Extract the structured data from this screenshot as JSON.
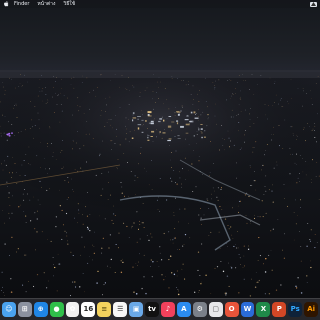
{
  "menubar": {
    "menus": [
      {
        "label": "Finder"
      },
      {
        "label": "หน้าต่าง"
      },
      {
        "label": "วิธีใช้"
      }
    ]
  },
  "desktop": {
    "wallpaper": "night-city-aerial"
  },
  "dock": {
    "apps": [
      {
        "name": "finder-icon",
        "bg": "#4aa3ef",
        "glyph": "☺"
      },
      {
        "name": "launchpad-icon",
        "bg": "#8c92a0",
        "glyph": "⊞"
      },
      {
        "name": "safari-icon",
        "bg": "#1f86e6",
        "glyph": "⊕"
      },
      {
        "name": "messages-icon",
        "bg": "#2fbf4a",
        "glyph": "●"
      },
      {
        "name": "photos-icon",
        "bg": "#f1f1f1",
        "glyph": "✿"
      },
      {
        "name": "calendar-icon",
        "bg": "#ffffff",
        "glyph": "16",
        "fg": "#222222"
      },
      {
        "name": "notes-icon",
        "bg": "#f4d35e",
        "glyph": "≡",
        "fg": "#6a5a1a"
      },
      {
        "name": "reminders-icon",
        "bg": "#f7f7f7",
        "glyph": "☰",
        "fg": "#444444"
      },
      {
        "name": "preview-icon",
        "bg": "#6aa9e8",
        "glyph": "▣"
      },
      {
        "name": "apple-tv-icon",
        "bg": "#111111",
        "glyph": "tv"
      },
      {
        "name": "music-icon",
        "bg": "#f2415c",
        "glyph": "♪"
      },
      {
        "name": "app-store-icon",
        "bg": "#2b8cf0",
        "glyph": "A"
      },
      {
        "name": "system-preferences-icon",
        "bg": "#7b8089",
        "glyph": "⚙"
      },
      {
        "name": "generic-app-icon",
        "bg": "#e7e7ea",
        "glyph": "▢",
        "fg": "#555555"
      },
      {
        "name": "office-icon",
        "bg": "#e8543a",
        "glyph": "O"
      },
      {
        "name": "word-icon",
        "bg": "#2b6cd8",
        "glyph": "W"
      },
      {
        "name": "excel-icon",
        "bg": "#1f8a49",
        "glyph": "X"
      },
      {
        "name": "powerpoint-icon",
        "bg": "#d24726",
        "glyph": "P"
      },
      {
        "name": "photoshop-icon",
        "bg": "#0e2239",
        "glyph": "Ps",
        "fg": "#31a8ff"
      },
      {
        "name": "illustrator-icon",
        "bg": "#2e1500",
        "glyph": "Ai",
        "fg": "#ff9a00"
      }
    ]
  }
}
